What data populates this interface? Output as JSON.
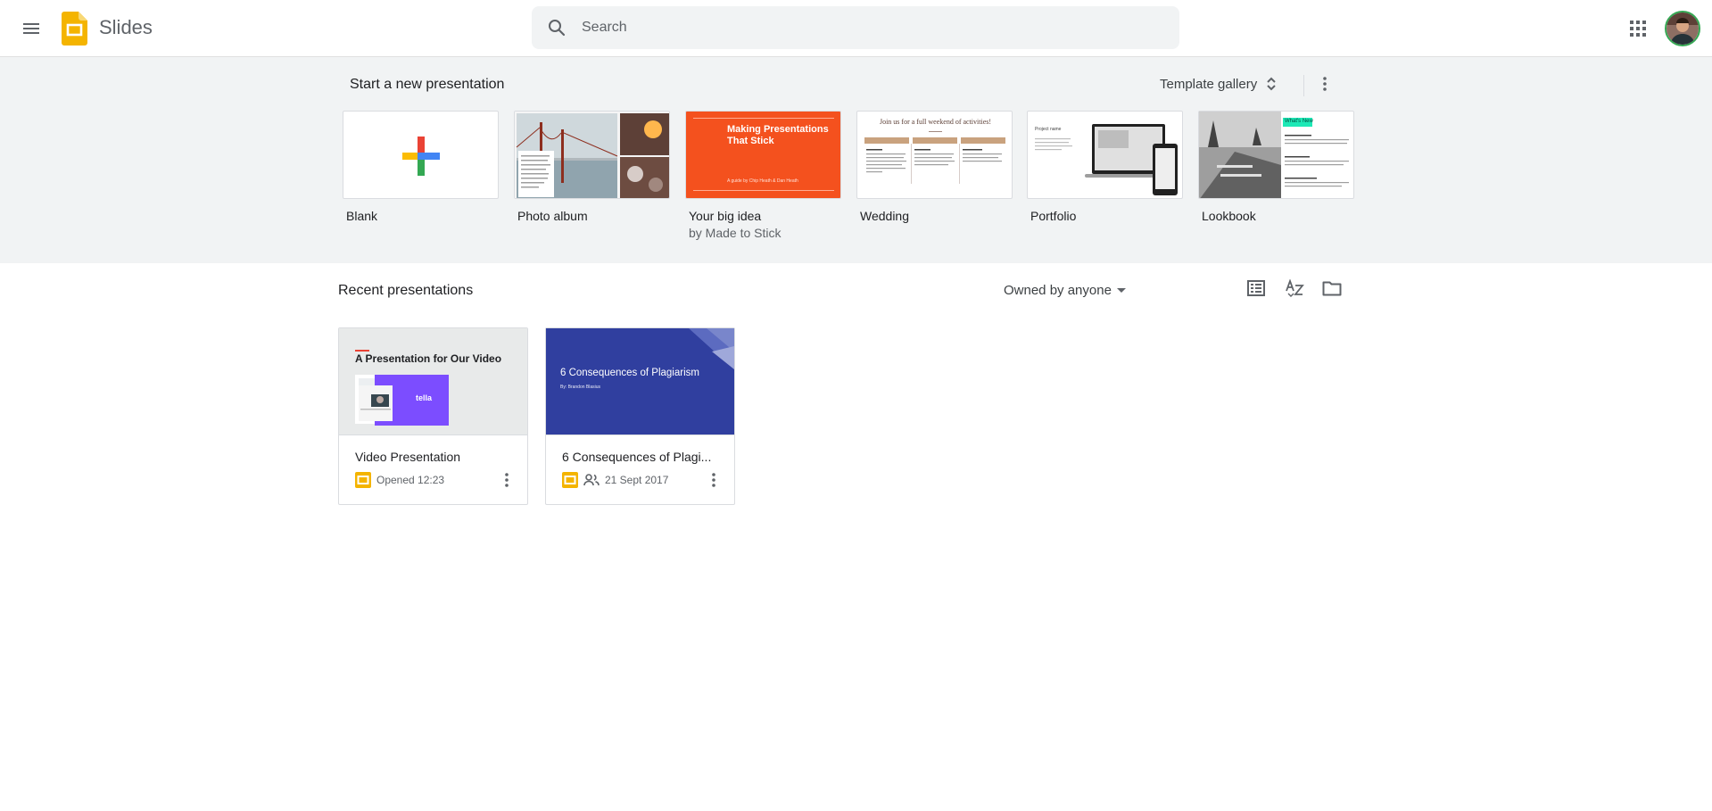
{
  "header": {
    "app_name": "Slides",
    "search_placeholder": "Search"
  },
  "templates": {
    "title": "Start a new presentation",
    "gallery_label": "Template gallery",
    "items": [
      {
        "name": "Blank",
        "sub": ""
      },
      {
        "name": "Photo album",
        "sub": ""
      },
      {
        "name": "Your big idea",
        "sub": "by Made to Stick"
      },
      {
        "name": "Wedding",
        "sub": ""
      },
      {
        "name": "Portfolio",
        "sub": ""
      },
      {
        "name": "Lookbook",
        "sub": ""
      }
    ],
    "big_idea_thumb": {
      "title": "Making Presentations That Stick",
      "byline": "A guide by Chip Heath & Dan Heath"
    },
    "wedding_thumb": {
      "title": "Join us for a full weekend of activities!"
    },
    "portfolio_thumb": {
      "title": "Project name"
    },
    "lookbook_thumb": {
      "title": "What's New"
    }
  },
  "recent": {
    "title": "Recent presentations",
    "owner_filter": "Owned by anyone",
    "docs": [
      {
        "name": "Video Presentation",
        "meta": "Opened 12:23",
        "shared": false,
        "thumb_title": "A Presentation for Our Video",
        "thumb_brand": "tella"
      },
      {
        "name": "6 Consequences of Plagi...",
        "meta": "21 Sept 2017",
        "shared": true,
        "thumb_title": "6 Consequences of Plagiarism",
        "thumb_byline": "By: Brandon Blasius"
      }
    ]
  },
  "colors": {
    "slides_yellow": "#f4b400",
    "big_idea_orange": "#f4511e",
    "plagiarism_blue": "#303f9f",
    "tella_purple": "#7c4dff"
  }
}
